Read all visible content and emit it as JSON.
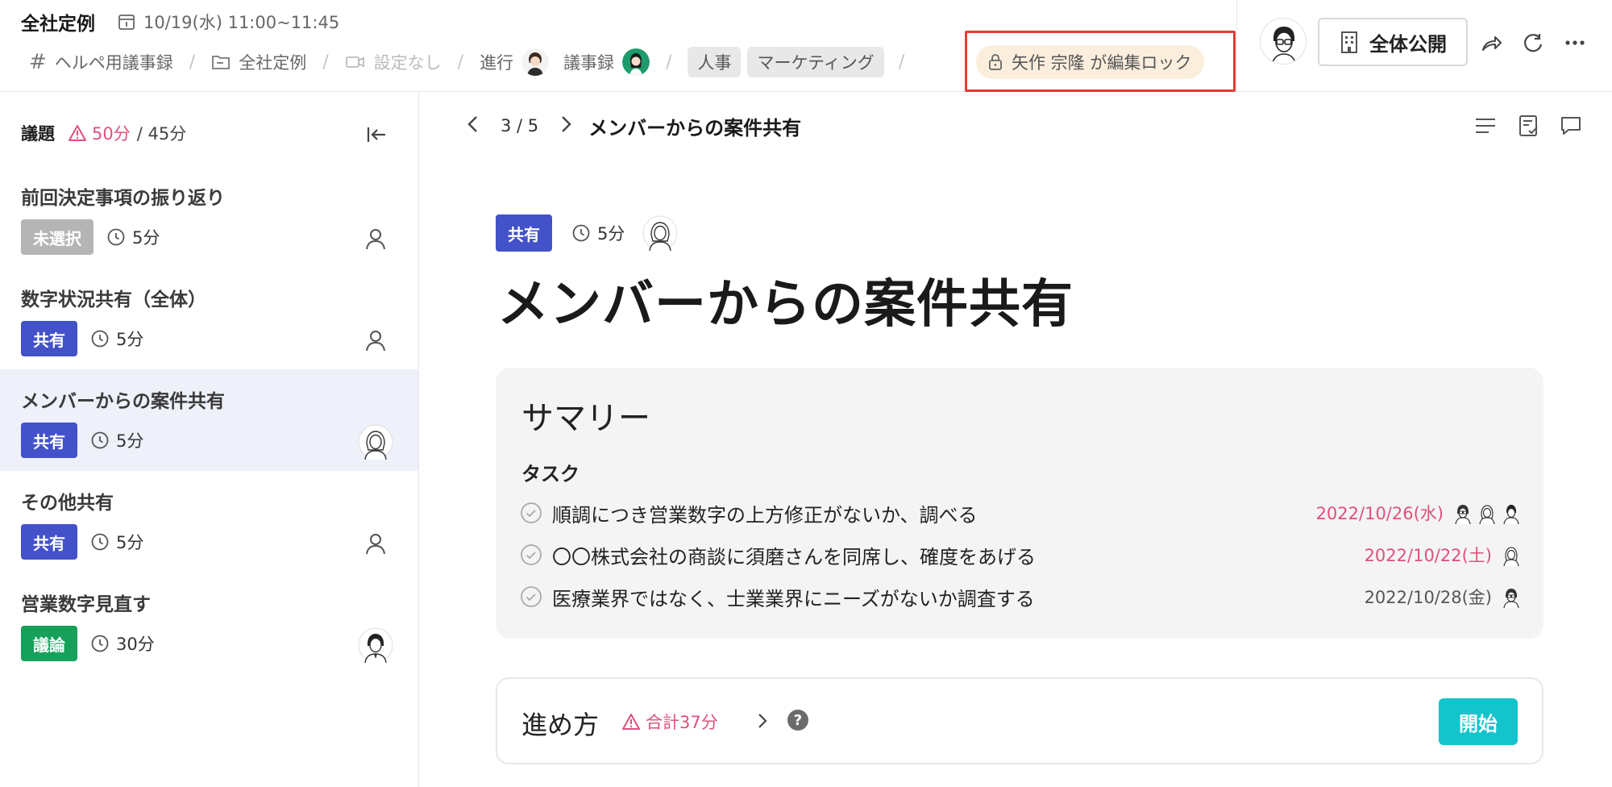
{
  "header": {
    "title": "全社定例",
    "datetime": "10/19(水) 11:00~11:45",
    "breadcrumbs": {
      "template": "ヘルペ用議事録",
      "folder": "全社定例",
      "video": "設定なし",
      "facilitator_label": "進行",
      "minutes_label": "議事録",
      "tags": [
        "人事",
        "マーケティング"
      ]
    },
    "lock_status": "矢作 宗隆 が編集ロック",
    "public_button": "全体公開",
    "colors": {
      "lock_outline": "#e23b31",
      "lock_bg": "#fbeedd"
    }
  },
  "sidebar": {
    "heading": "議題",
    "overtime": "50分",
    "total": "/ 45分",
    "items": [
      {
        "title": "前回決定事項の振り返り",
        "badge": "未選択",
        "badge_color": "#b5b5b5",
        "duration": "5分",
        "owner": "person-icon",
        "active": false
      },
      {
        "title": "数字状況共有（全体）",
        "badge": "共有",
        "badge_color": "#4352c8",
        "duration": "5分",
        "owner": "person-icon",
        "active": false
      },
      {
        "title": "メンバーからの案件共有",
        "badge": "共有",
        "badge_color": "#4352c8",
        "duration": "5分",
        "owner": "avatar-woman",
        "active": true
      },
      {
        "title": "その他共有",
        "badge": "共有",
        "badge_color": "#4352c8",
        "duration": "5分",
        "owner": "person-icon",
        "active": false
      },
      {
        "title": "営業数字見直す",
        "badge": "議論",
        "badge_color": "#16a05a",
        "duration": "30分",
        "owner": "avatar-man",
        "active": false
      }
    ]
  },
  "main": {
    "pager": {
      "position": "3 / 5",
      "title": "メンバーからの案件共有"
    },
    "item": {
      "badge": "共有",
      "duration": "5分",
      "title": "メンバーからの案件共有"
    },
    "summary": {
      "heading": "サマリー",
      "tasks_heading": "タスク",
      "tasks": [
        {
          "text": "順調につき営業数字の上方修正がないか、調べる",
          "date": "2022/10/26(水)",
          "overdue": true,
          "assignees": 3
        },
        {
          "text": "〇〇株式会社の商談に須磨さんを同席し、確度をあげる",
          "date": "2022/10/22(土)",
          "overdue": true,
          "assignees": 1
        },
        {
          "text": "医療業界ではなく、士業業界にニーズがないか調査する",
          "date": "2022/10/28(金)",
          "overdue": false,
          "assignees": 1
        }
      ]
    },
    "progress": {
      "label": "進め方",
      "warning": "合計37分",
      "help": "?",
      "start_button": "開始"
    }
  }
}
